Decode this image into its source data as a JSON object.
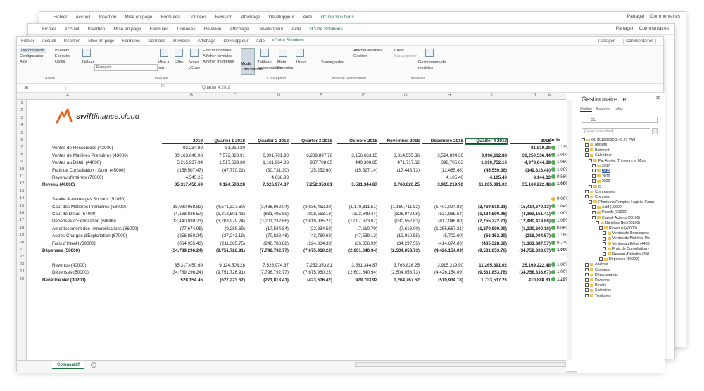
{
  "back_windows": {
    "menu": [
      "Fichier",
      "Accueil",
      "Insertion",
      "Mise en page",
      "Formules",
      "Données",
      "Révision",
      "Affichage",
      "Développeur",
      "Aide",
      "vCube Solutions"
    ],
    "share": "Partager",
    "comments": "Commentaires"
  },
  "menubar": {
    "items": [
      "Fichier",
      "Accueil",
      "Insertion",
      "Mise en page",
      "Formules",
      "Données",
      "Révision",
      "Affichage",
      "Développeur",
      "Aide",
      "vCube Solutions"
    ],
    "active": "vCube Solutions",
    "share": "Partager",
    "comments": "Commentaires"
  },
  "ribbon": {
    "connexion": "Déconnexion",
    "configuration": "Configuration",
    "aide": "Aide",
    "vsheets": "vSheets",
    "exécuter": "Exécuter",
    "outils": "Outils",
    "déluer": "Déluer",
    "langue": "Français",
    "group_addin": "Addin",
    "mise_a_jour": "Mise à jour",
    "filtre": "Filtre",
    "notes": "Notes vCube",
    "effacer": "Effacer données",
    "afficher_formules": "Afficher formules",
    "afficher_modifiees": "Afficher modifiées",
    "group_vfeuille": "vFeuille",
    "mode_conception": "Mode Conception",
    "tableau": "Tableau personnalisés",
    "meta": "Méta Données",
    "undo": "Undo",
    "group_conception": "Conception",
    "sauvegarder": "Sauvegarder",
    "afficher_modeles": "Afficher éviables",
    "gestion": "Gestion",
    "group_planif": "Module Planification",
    "creer": "Créer",
    "sauvegarder2": "Sauvegarder",
    "gestionnaire": "Gestionnaire de modèles",
    "group_modeles": "Modèles"
  },
  "formula_bar": {
    "cell": "J6",
    "fx": "fx",
    "value": "'Quarter 4 2018"
  },
  "columns": [
    "A",
    "B",
    "C",
    "D",
    "E",
    "F",
    "G",
    "H",
    "I",
    "J",
    "K",
    "L"
  ],
  "logo": {
    "brand": "swift",
    "rest": "finance.cloud"
  },
  "table": {
    "headers": [
      "2019",
      "Quarter 1 2018",
      "Quarter 2 2018",
      "Quarter 3 2018",
      "Octobre 2018",
      "Novembre 2018",
      "Décembre 2018",
      "Quarter 4 2018",
      "2018",
      "Var %"
    ],
    "rows": [
      {
        "n": "7",
        "label": "Ventes de Ressources (42000)",
        "indent": true,
        "bold": false,
        "vals": [
          "92,234.89",
          "81,810.30",
          "",
          "",
          "",
          "",
          "",
          "",
          "81,810.30"
        ],
        "var": "1.13%"
      },
      {
        "n": "8",
        "label": "Ventes de Matières Premières (43000)",
        "indent": true,
        "bold": false,
        "vals": [
          "30,163,040.08",
          "7,572,823.91",
          "6,391,701.90",
          "6,289,897.76",
          "3,156,663.15",
          "3,314,555.36",
          "3,524,894.36",
          "9,996,112.88",
          "30,250,536.44"
        ],
        "var": "1.00%"
      },
      {
        "n": "9",
        "label": "Ventes au Détail (44000)",
        "indent": true,
        "bold": false,
        "vals": [
          "5,215,937.94",
          "1,517,639.30",
          "1,161,964.83",
          "987,708.65",
          "440,308.85",
          "471,717.62",
          "398,705.63",
          "1,310,752.10",
          "4,978,044.89"
        ],
        "var": "1.05%"
      },
      {
        "n": "10",
        "label": "Frais de Consultation - Dom. (45000)",
        "indent": true,
        "bold": false,
        "vals": [
          "(158,507.47)",
          "(47,770.22)",
          "(30,731.30)",
          "(25,252.60)",
          "(15,627.14)",
          "(17,446.73)",
          "(12,485.48)",
          "(45,559.36)",
          "(149,313.48)"
        ],
        "var": "1.06%"
      },
      {
        "n": "11",
        "label": "Revenu d'Intérêts (70000)",
        "indent": true,
        "bold": false,
        "vals": [
          "4,545.25",
          "",
          "4,038.93",
          "",
          "",
          "",
          "4,105.40",
          "4,105.40",
          "8,144.33"
        ],
        "var": "0.56%"
      },
      {
        "n": "12",
        "label": "Revenu (40000)",
        "indent": false,
        "bold": true,
        "vals": [
          "35,317,450.69",
          "9,124,503.28",
          "7,526,974.37",
          "7,252,353.81",
          "3,581,344.87",
          "3,768,826.25",
          "3,915,219.90",
          "11,265,391.02",
          "35,169,222.48"
        ],
        "var": "1.00%"
      },
      {
        "n": "13",
        "label": "",
        "indent": true,
        "bold": false,
        "vals": [
          "",
          "",
          "",
          "",
          "",
          "",
          "",
          "",
          ""
        ],
        "var": ""
      },
      {
        "n": "14",
        "label": "Salaire & Avantages Sociaux (51050)",
        "indent": true,
        "bold": false,
        "vals": [
          "",
          "",
          "",
          "",
          "",
          "",
          "",
          "",
          ""
        ],
        "var": "0.00%",
        "orange": true
      },
      {
        "n": "15",
        "label": "Coût des Matières Premières (53000)",
        "indent": true,
        "bold": false,
        "vals": [
          "(15,980,958.82)",
          "(4,571,327.60)",
          "(3,436,862.04)",
          "(3,636,462.28)",
          "(1,178,811.51)",
          "(1,189,711.82)",
          "(1,401,094.88)",
          "(3,769,618.21)",
          "(15,414,270.13)"
        ],
        "var": "1.04%"
      },
      {
        "n": "16",
        "label": "Coût de Détail (54000)",
        "indent": true,
        "bold": false,
        "vals": [
          "(4,168,826.57)",
          "(1,218,501.43)",
          "(831,495.89)",
          "(928,563.13)",
          "(323,649.44)",
          "(328,972.98)",
          "(531,968.54)",
          "(1,184,590.96)",
          "(4,163,151.41)"
        ],
        "var": "1.00%"
      },
      {
        "n": "17",
        "label": "Dépenses d'Exploitation (60000)",
        "indent": true,
        "bold": false,
        "vals": [
          "(13,440,030.23)",
          "(3,703,979.24)",
          "(3,201,232.66)",
          "(2,819,935.27)",
          "(1,007,673.07)",
          "(930,552.83)",
          "(817,046.80)",
          "(2,755,272.71)",
          "(12,480,419.88)"
        ],
        "var": "1.08%"
      },
      {
        "n": "18",
        "label": "Amortissement des Immobilisations (66000)",
        "indent": true,
        "bold": false,
        "vals": [
          "(77,674.95)",
          "(9,289.69)",
          "(17,584.84)",
          "(22,834.58)",
          "(7,610.79)",
          "(7,613.00)",
          "(1,255,667.21)",
          "(1,270,890.99)",
          "(1,320,600.10)"
        ],
        "var": "0.06%"
      },
      {
        "n": "19",
        "label": "Autres Charges d'Exploitation (67000)",
        "indent": true,
        "bold": false,
        "vals": [
          "(256,850.24)",
          "(37,243.19)",
          "(70,828.46)",
          "(43,780.63)",
          "(47,539.13)",
          "(12,910.55)",
          "(5,702.60)",
          "(66,152.29)",
          "(218,004.57)"
        ],
        "var": "1.18%"
      },
      {
        "n": "20",
        "label": "Frais d'Intérêt (80000)",
        "indent": true,
        "bold": false,
        "vals": [
          "(864,955.43)",
          "(211,385.75)",
          "(240,788.88)",
          "(224,384.33)",
          "(36,356.99)",
          "(34,297.55)",
          "(414,674.06)",
          "(485,328.60)",
          "(1,161,887.57)"
        ],
        "var": "0.74%"
      },
      {
        "n": "21",
        "label": "Dépenses (50000)",
        "indent": false,
        "bold": true,
        "vals": [
          "(34,789,296.24)",
          "(9,751,726.91)",
          "(7,798,792.77)",
          "(7,675,960.23)",
          "(2,601,640.94)",
          "(2,504,058.73)",
          "(4,426,154.09)",
          "(9,531,853.76)",
          "(34,758,333.67)"
        ],
        "var": "1.00%"
      },
      {
        "n": "22",
        "label": "",
        "indent": true,
        "bold": false,
        "vals": [
          "",
          "",
          "",
          "",
          "",
          "",
          "",
          "",
          ""
        ],
        "var": ""
      },
      {
        "n": "23",
        "label": "Revenus (40000)",
        "indent": true,
        "bold": false,
        "vals": [
          "35,317,450.69",
          "9,124,503.28",
          "7,526,974.37",
          "7,252,353.81",
          "3,581,344.87",
          "3,768,826.25",
          "3,915,219.90",
          "11,265,391.02",
          "35,169,222.48"
        ],
        "var": "1.00%"
      },
      {
        "n": "24",
        "label": "Dépenses (50000)",
        "indent": true,
        "bold": false,
        "vals": [
          "(34,789,296.24)",
          "(9,751,726.91)",
          "(7,798,792.77)",
          "(7,675,960.23)",
          "(2,601,640.94)",
          "(2,504,058.73)",
          "(4,426,154.09)",
          "(9,531,853.76)",
          "(34,758,333.67)"
        ],
        "var": "1.00%"
      },
      {
        "n": "25",
        "label": "Bénéfice Net (30200)",
        "indent": false,
        "bold": true,
        "vals": [
          "528,154.45",
          "(627,223.62)",
          "(271,818.41)",
          "(423,606.42)",
          "979,703.92",
          "1,264,767.52",
          "(510,934.18)",
          "1,733,537.26",
          "410,888.81"
        ],
        "var": "1.29%"
      }
    ]
  },
  "sheet_tab": "Comparatif",
  "panel": {
    "title": "Gestionnaire de ...",
    "tabs": [
      "Outline",
      "Explorer",
      "Infos"
    ],
    "select": "GL",
    "search": "[Search member]",
    "tree": [
      {
        "d": 0,
        "t": "GL [2/19/2020 2:45:27 PM]"
      },
      {
        "d": 1,
        "t": "Mesure"
      },
      {
        "d": 1,
        "t": "Batiment"
      },
      {
        "d": 1,
        "t": "Calendrier"
      },
      {
        "d": 2,
        "t": "Par Année, Trimestre et Mois"
      },
      {
        "d": 3,
        "t": "2017"
      },
      {
        "d": 3,
        "t": "2018",
        "hl": true
      },
      {
        "d": 3,
        "t": "2019"
      },
      {
        "d": 3,
        "t": "2020"
      },
      {
        "d": 2,
        "t": "C"
      },
      {
        "d": 1,
        "t": "Compagnies"
      },
      {
        "d": 1,
        "t": "Comptes"
      },
      {
        "d": 2,
        "t": "Charte de Comptes Logiciel Comp"
      },
      {
        "d": 3,
        "t": "Actif (10000)"
      },
      {
        "d": 3,
        "t": "Passifs (21000)"
      },
      {
        "d": 3,
        "t": "Capital-Actions (30100)"
      },
      {
        "d": 4,
        "t": "Bénéfice Net (30200)"
      },
      {
        "d": 5,
        "t": "Revenus (40000)"
      },
      {
        "d": 6,
        "t": "Ventes de Ressources"
      },
      {
        "d": 6,
        "t": "Ventes de Matières Pre"
      },
      {
        "d": 6,
        "t": "Ventes au Détail (4400"
      },
      {
        "d": 6,
        "t": "Frais de Consultation -"
      },
      {
        "d": 6,
        "t": "Revenu d'Intérêts (700"
      },
      {
        "d": 5,
        "t": "Dépenses (50000)"
      },
      {
        "d": 1,
        "t": "Analyse"
      },
      {
        "d": 1,
        "t": "Currency"
      },
      {
        "d": 1,
        "t": "Départements"
      },
      {
        "d": 1,
        "t": "Divisions"
      },
      {
        "d": 1,
        "t": "Projets"
      },
      {
        "d": 1,
        "t": "Scénarios"
      },
      {
        "d": 1,
        "t": "Territoires"
      }
    ]
  }
}
